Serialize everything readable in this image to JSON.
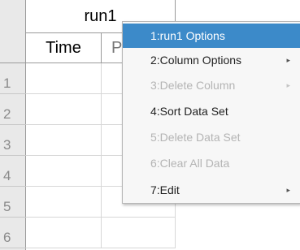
{
  "table": {
    "title": "run1",
    "columns": [
      "Time",
      "Pre"
    ],
    "row_numbers": [
      "1",
      "2",
      "3",
      "4",
      "5",
      "6"
    ]
  },
  "menu": {
    "items": [
      {
        "label": "1:run1 Options",
        "selected": true,
        "enabled": true,
        "submenu": false
      },
      {
        "label": "2:Column Options",
        "selected": false,
        "enabled": true,
        "submenu": true
      },
      {
        "label": "3:Delete Column",
        "selected": false,
        "enabled": false,
        "submenu": true
      },
      {
        "label": "4:Sort Data Set",
        "selected": false,
        "enabled": true,
        "submenu": false
      },
      {
        "label": "5:Delete Data Set",
        "selected": false,
        "enabled": false,
        "submenu": false
      },
      {
        "label": "6:Clear All Data",
        "selected": false,
        "enabled": false,
        "submenu": false
      },
      {
        "label": "7:Edit",
        "selected": false,
        "enabled": true,
        "submenu": true
      }
    ],
    "submenu_arrow": "▸"
  },
  "colors": {
    "selection": "#3c8ac9",
    "header_bg": "#e9e9e9",
    "disabled_text": "#b4b4b4"
  }
}
